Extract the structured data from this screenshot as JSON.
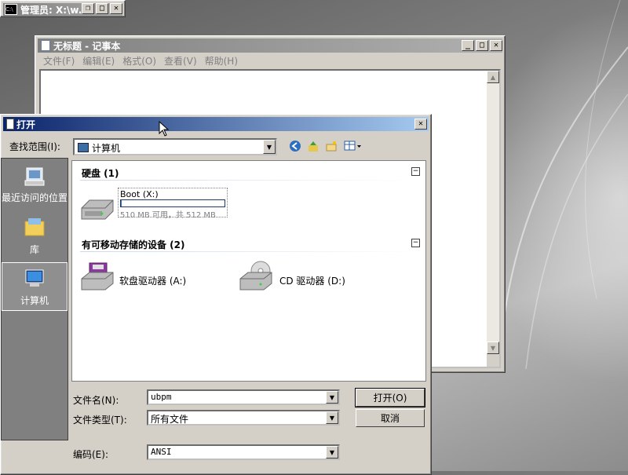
{
  "console": {
    "title": "管理员: X:\\w...",
    "icon": "cmd-icon"
  },
  "notepad": {
    "title": "无标题 - 记事本",
    "menu": [
      "文件(F)",
      "编辑(E)",
      "格式(O)",
      "查看(V)",
      "帮助(H)"
    ]
  },
  "dialog": {
    "title": "打开",
    "look_in_label": "查找范围(I):",
    "look_in_value": "计算机",
    "places": [
      "最近访问的位置",
      "库",
      "计算机"
    ],
    "groups": [
      {
        "name": "硬盘 (1)"
      },
      {
        "name": "有可移动存储的设备 (2)"
      }
    ],
    "drives": {
      "boot": {
        "name": "Boot (X:)",
        "capacity": "510 MB 可用，共 512 MB",
        "used_fraction": 0.004
      },
      "floppy": {
        "name": "软盘驱动器 (A:)"
      },
      "cd": {
        "name": "CD 驱动器 (D:)"
      }
    },
    "filename_label": "文件名(N):",
    "filename_value": "ubpm",
    "filetype_label": "文件类型(T):",
    "filetype_value": "所有文件",
    "encoding_label": "编码(E):",
    "encoding_value": "ANSI",
    "open_button": "打开(O)",
    "cancel_button": "取消"
  },
  "colors": {
    "dialog_title": "#0a246a",
    "selection": "#8f8f8f"
  }
}
